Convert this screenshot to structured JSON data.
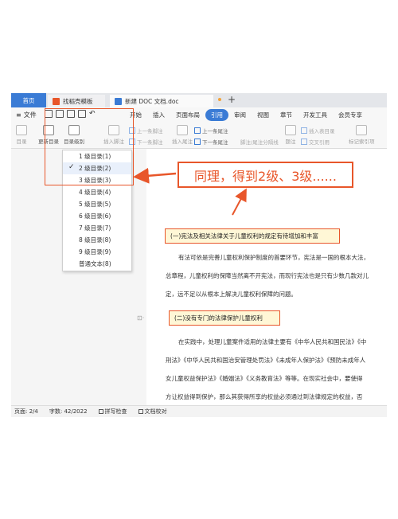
{
  "titlebar": {
    "tabs": [
      {
        "label": "首页"
      },
      {
        "label": "找稻壳模板"
      },
      {
        "label": "新建 DOC 文档.doc"
      }
    ],
    "new_tab": "+"
  },
  "menubar": {
    "file": "文件",
    "items": [
      "开始",
      "插入",
      "页面布局",
      "引用",
      "审阅",
      "视图",
      "章节",
      "开发工具",
      "会员专享"
    ],
    "active": "引用"
  },
  "ribbon": {
    "toc": "目录",
    "update_toc": "更新目录",
    "toc_level": "目录级别",
    "insert_footnote": "插入脚注",
    "prev_footnote": "上一条脚注",
    "next_footnote": "下一条脚注",
    "insert_endnote": "插入尾注",
    "prev_endnote": "上一条尾注",
    "next_endnote": "下一条尾注",
    "footnote_endnote_sep": "脚注/尾注分隔线",
    "caption": "题注",
    "insert_table_of_figures": "插入表目录",
    "cross_ref": "交叉引用",
    "mark_index": "标记索引项"
  },
  "dropdown": {
    "items": [
      {
        "label": "1 级目录(1)",
        "checked": false
      },
      {
        "label": "2 级目录(2)",
        "checked": true
      },
      {
        "label": "3 级目录(3)",
        "checked": false
      },
      {
        "label": "4 级目录(4)",
        "checked": false
      },
      {
        "label": "5 级目录(5)",
        "checked": false
      },
      {
        "label": "6 级目录(6)",
        "checked": false
      },
      {
        "label": "7 级目录(7)",
        "checked": false
      },
      {
        "label": "8 级目录(8)",
        "checked": false
      },
      {
        "label": "9 级目录(9)",
        "checked": false
      },
      {
        "label": "普通文本(8)",
        "checked": false
      }
    ]
  },
  "annotation": {
    "callout": "同理，得到2级、3级......"
  },
  "document": {
    "heading1": "(一)宪法及相关法律关于儿童权利的规定有待增加和丰富",
    "para1": [
      "有法可依是完善儿童权利保护制度的首要环节，宪法是一国的根本大法，",
      "总章程，儿童权利的保障当然离不开宪法，而现行宪法也是只有少数几款对儿",
      "定，远不足以从根本上解决儿童权利保障的问题。"
    ],
    "heading2": "(二)没有专门的法律保护儿童权利",
    "para2": [
      "在实践中，处理儿童案件适用的法律主要有《中华人民共和国民法》《中",
      "刑法》《中华人民共和国治安管理处罚法》《未成年人保护法》《预防未成年人",
      "女儿童权益保护法》《婚姻法》《义务教育法》等等。在现实社会中，要使得",
      "方让权益得到保护，那么其获得所享的权益必须通过到法律规定的权益，否"
    ]
  },
  "status": {
    "page": "页面: 2/4",
    "words": "字数: 42/2022",
    "spell": "拼写检查",
    "doc_check": "文档校对"
  },
  "colors": {
    "accent": "#3a7bd5",
    "annotation": "#e8562a"
  }
}
